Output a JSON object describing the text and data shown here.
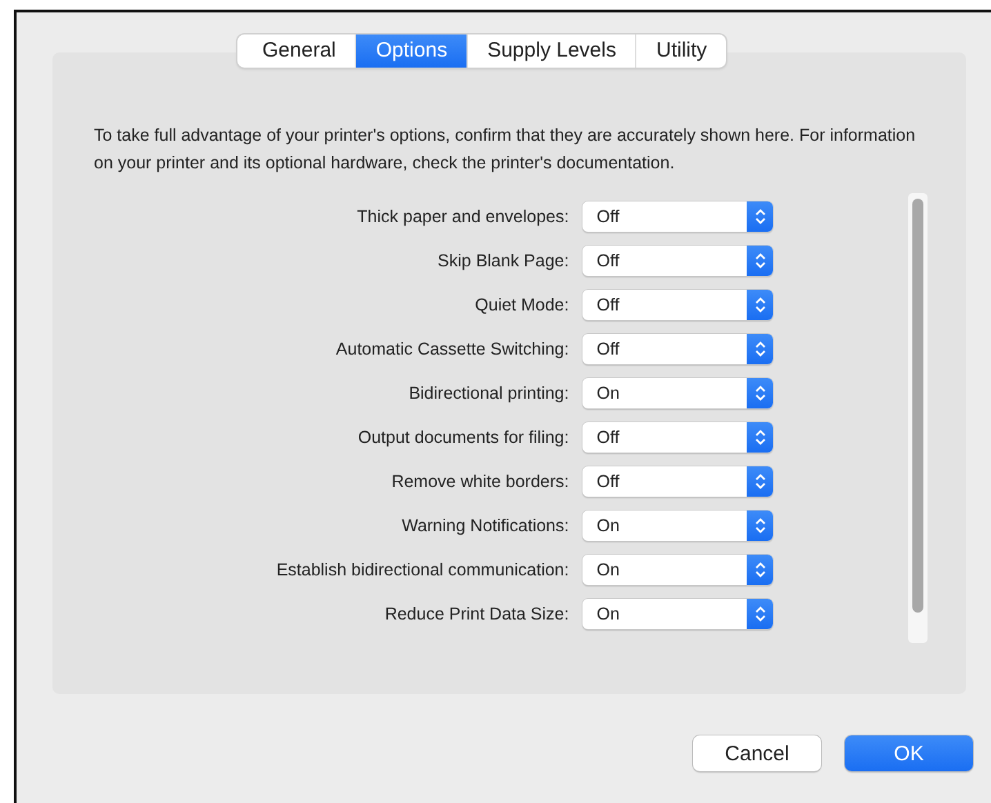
{
  "tabs": [
    {
      "label": "General",
      "selected": false
    },
    {
      "label": "Options",
      "selected": true
    },
    {
      "label": "Supply Levels",
      "selected": false
    },
    {
      "label": "Utility",
      "selected": false
    }
  ],
  "description": "To take full advantage of your printer's options, confirm that they are accurately shown here. For information on your printer and its optional hardware, check the printer's documentation.",
  "options": [
    {
      "label": "Thick paper and envelopes:",
      "value": "Off"
    },
    {
      "label": "Skip Blank Page:",
      "value": "Off"
    },
    {
      "label": "Quiet Mode:",
      "value": "Off"
    },
    {
      "label": "Automatic Cassette Switching:",
      "value": "Off"
    },
    {
      "label": "Bidirectional printing:",
      "value": "On"
    },
    {
      "label": "Output documents for filing:",
      "value": "Off"
    },
    {
      "label": "Remove white borders:",
      "value": "Off"
    },
    {
      "label": "Warning Notifications:",
      "value": "On"
    },
    {
      "label": "Establish bidirectional communication:",
      "value": "On"
    },
    {
      "label": "Reduce Print Data Size:",
      "value": "On"
    }
  ],
  "buttons": [
    {
      "label": "Cancel",
      "kind": "normal"
    },
    {
      "label": "OK",
      "kind": "default"
    }
  ]
}
